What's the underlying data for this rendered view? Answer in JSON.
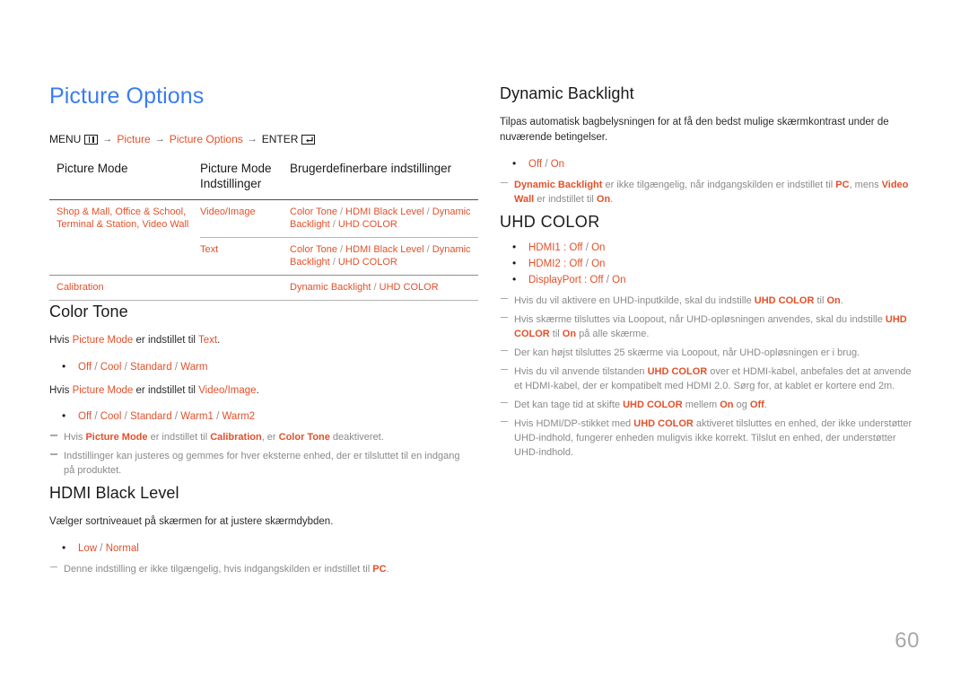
{
  "page": {
    "title": "Picture Options",
    "page_number": "60"
  },
  "breadcrumb": {
    "menu_label": "MENU",
    "menu_icon": "menu-grid-icon",
    "arrow": "→",
    "item1": "Picture",
    "item2": "Picture Options",
    "enter_label": "ENTER",
    "enter_icon": "enter-key-icon"
  },
  "table": {
    "headers": {
      "col1": "Picture Mode",
      "col2": "Picture Mode Indstillinger",
      "col3": "Brugerdefinerbare indstillinger"
    },
    "rows": [
      {
        "col1": "Shop & Mall, Office & School, Terminal & Station, Video Wall",
        "col2": "Video/Image",
        "col3": "Color Tone / HDMI Black Level / Dynamic Backlight / UHD COLOR"
      },
      {
        "col1": "",
        "col2": "Text",
        "col3": "Color Tone / HDMI Black Level / Dynamic Backlight / UHD COLOR"
      },
      {
        "col1": "Calibration",
        "col2": "",
        "col3": "Dynamic Backlight / UHD COLOR"
      }
    ]
  },
  "color_tone": {
    "heading": "Color Tone",
    "line1_pre": "Hvis ",
    "line1_red1": "Picture Mode",
    "line1_mid": " er indstillet til ",
    "line1_red2": "Text",
    "line1_post": ".",
    "options1": "Off / Cool / Standard / Warm",
    "line2_pre": "Hvis ",
    "line2_red1": "Picture Mode",
    "line2_mid": " er indstillet til ",
    "line2_red2": "Video/Image",
    "line2_post": ".",
    "options2": "Off / Cool / Standard / Warm1 / Warm2",
    "note1_a": "Hvis ",
    "note1_b": "Picture Mode",
    "note1_c": " er indstillet til ",
    "note1_d": "Calibration",
    "note1_e": ", er ",
    "note1_f": "Color Tone",
    "note1_g": " deaktiveret.",
    "note2": "Indstillinger kan justeres og gemmes for hver eksterne enhed, der er tilsluttet til en indgang på produktet."
  },
  "hdmi_black_level": {
    "heading": "HDMI Black Level",
    "description": "Vælger sortniveauet på skærmen for at justere skærmdybden.",
    "options": "Low / Normal",
    "note_a": "Denne indstilling er ikke tilgængelig, hvis indgangskilden er indstillet til ",
    "note_b": "PC",
    "note_c": "."
  },
  "dynamic_backlight": {
    "heading": "Dynamic Backlight",
    "description": "Tilpas automatisk bagbelysningen for at få den bedst mulige skærmkontrast under de nuværende betingelser.",
    "options": "Off / On",
    "note_a": "Dynamic Backlight",
    "note_b": " er ikke tilgængelig, når indgangskilden er indstillet til ",
    "note_c": "PC",
    "note_d": ", mens ",
    "note_e": "Video Wall",
    "note_f": " er indstillet til ",
    "note_g": "On",
    "note_h": "."
  },
  "uhd_color": {
    "heading": "UHD COLOR",
    "options": [
      {
        "label": "HDMI1 : ",
        "v1": "Off",
        "sep": " / ",
        "v2": "On"
      },
      {
        "label": "HDMI2 : ",
        "v1": "Off",
        "sep": " / ",
        "v2": "On"
      },
      {
        "label": "DisplayPort : ",
        "v1": "Off",
        "sep": " / ",
        "v2": "On"
      }
    ],
    "note1_a": "Hvis du vil aktivere en UHD-inputkilde, skal du indstille ",
    "note1_b": "UHD COLOR",
    "note1_c": " til ",
    "note1_d": "On",
    "note1_e": ".",
    "note2_a": "Hvis skærme tilsluttes via Loopout, når UHD-opløsningen anvendes, skal du indstille ",
    "note2_b": "UHD COLOR",
    "note2_c": " til ",
    "note2_d": "On",
    "note2_e": " på alle skærme.",
    "note3": "Der kan højst tilsluttes 25 skærme via Loopout, når UHD-opløsningen er i brug.",
    "note4_a": "Hvis du vil anvende tilstanden ",
    "note4_b": "UHD COLOR",
    "note4_c": " over et HDMI-kabel, anbefales det at anvende et HDMI-kabel, der er kompatibelt med HDMI 2.0. Sørg for, at kablet er kortere end 2m.",
    "note5_a": "Det kan tage tid at skifte ",
    "note5_b": "UHD COLOR",
    "note5_c": " mellem ",
    "note5_d": "On",
    "note5_e": " og ",
    "note5_f": "Off",
    "note5_g": ".",
    "note6_a": "Hvis HDMI/DP-stikket med ",
    "note6_b": "UHD COLOR",
    "note6_c": " aktiveret tilsluttes en enhed, der ikke understøtter UHD-indhold, fungerer enheden muligvis ikke korrekt. Tilslut en enhed, der understøtter UHD-indhold."
  },
  "colors": {
    "title_blue": "#3b7dee",
    "accent_red": "#e2512a",
    "note_gray": "#8a8a8a",
    "page_number_gray": "#a8a8a8"
  }
}
